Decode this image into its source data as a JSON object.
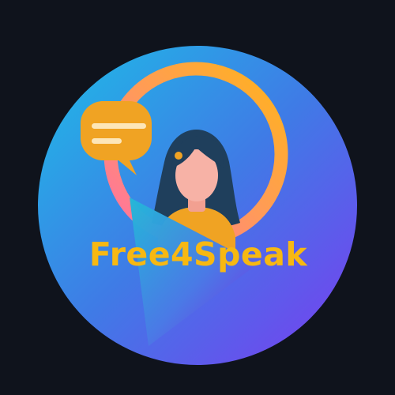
{
  "brand": {
    "name": "Free4Speak"
  },
  "colors": {
    "background": "#0f131c",
    "circle_gradient_start": "#21b4e6",
    "circle_gradient_mid": "#3a7de8",
    "circle_gradient_end": "#7b3ff0",
    "ring_start": "#ff7aa0",
    "ring_end": "#ffb21a",
    "speech_bubble": "#f0a323",
    "speech_lines": "#fde6b8",
    "hair": "#1f3f5c",
    "skin": "#f7b2a6",
    "shirt": "#f0a323",
    "text": "#f7b812",
    "play_gradient_start": "#1fb8d8",
    "play_gradient_end": "#7a2ce6"
  },
  "icons": {
    "speech_bubble": "speech-bubble-icon",
    "person": "person-avatar-icon",
    "play": "play-triangle-icon",
    "ring": "ring-icon"
  }
}
